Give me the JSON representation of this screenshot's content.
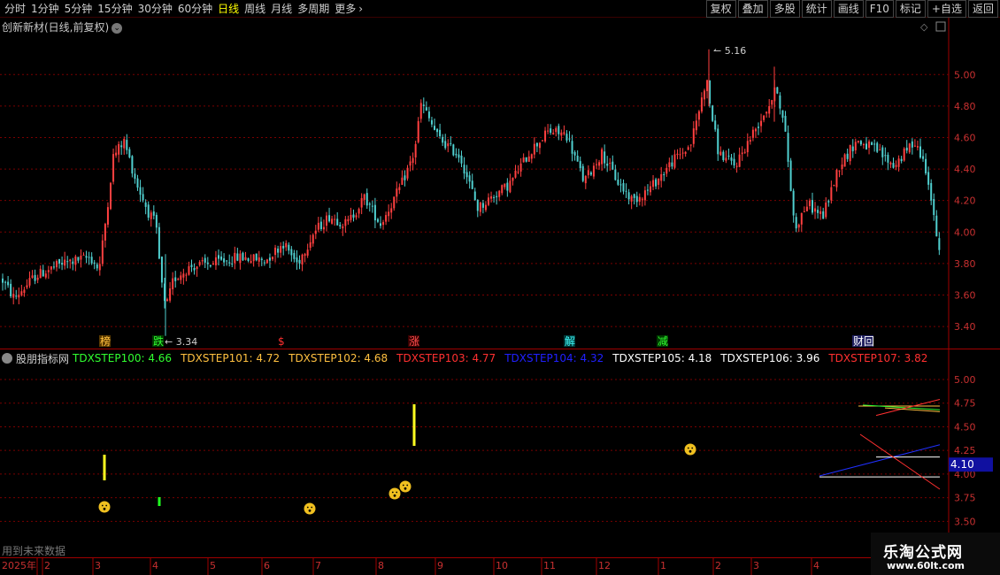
{
  "toolbar": {
    "periods": [
      "分时",
      "1分钟",
      "5分钟",
      "15分钟",
      "30分钟",
      "60分钟",
      "日线",
      "周线",
      "月线",
      "多周期",
      "更多"
    ],
    "active_period": "日线",
    "more_arrow": "›",
    "buttons": [
      "复权",
      "叠加",
      "多股",
      "统计",
      "画线",
      "F10",
      "标记",
      "+自选",
      "返回"
    ]
  },
  "subtitle": "创新新材(日线,前复权)",
  "price_axis": {
    "ticks": [
      "5.00",
      "4.80",
      "4.60",
      "4.40",
      "4.20",
      "4.00",
      "3.80",
      "3.60",
      "3.40"
    ],
    "tick_values": [
      5.0,
      4.8,
      4.6,
      4.4,
      4.2,
      4.0,
      3.8,
      3.6,
      3.4
    ],
    "ylim": [
      3.26,
      5.26
    ]
  },
  "annotations": {
    "high": "5.16",
    "low": "3.34"
  },
  "markers": [
    {
      "label": "榜",
      "color": "#ffc040",
      "bg": "#5a3a00"
    },
    {
      "label": "跌",
      "color": "#30ff30",
      "bg": "#003a00"
    },
    {
      "label": "$",
      "color": "#ff3030",
      "bg": "#000000"
    },
    {
      "label": "涨",
      "color": "#ff5050",
      "bg": "#3a0000"
    },
    {
      "label": "解",
      "color": "#40ffff",
      "bg": "#003a3a"
    },
    {
      "label": "减",
      "color": "#30ff30",
      "bg": "#003a00"
    },
    {
      "label": "财回",
      "color": "#ffffff",
      "bg": "#202060"
    }
  ],
  "indicator": {
    "name": "股朋指标网",
    "values": [
      {
        "label": "TDXSTEP100: 4.66",
        "color": "#30ff30"
      },
      {
        "label": "TDXSTEP101: 4.72",
        "color": "#ffc040"
      },
      {
        "label": "TDXSTEP102: 4.68",
        "color": "#ffc040"
      },
      {
        "label": "TDXSTEP103: 4.77",
        "color": "#ff3030"
      },
      {
        "label": "TDXSTEP104: 4.32",
        "color": "#2020ff"
      },
      {
        "label": "TDXSTEP105: 4.18",
        "color": "#ffffff"
      },
      {
        "label": "TDXSTEP106: 3.96",
        "color": "#ffffff"
      },
      {
        "label": "TDXSTEP107: 3.82",
        "color": "#ff3030"
      }
    ],
    "axis_ticks": [
      "5.00",
      "4.75",
      "4.50",
      "4.25",
      "4.00",
      "3.75",
      "3.50"
    ],
    "axis_values": [
      5.0,
      4.75,
      4.5,
      4.25,
      4.0,
      3.75,
      3.5
    ],
    "ylim": [
      3.4,
      5.15
    ],
    "current_value": "4.10"
  },
  "future_note": "用到未来数据",
  "date_axis": [
    "2025年",
    "2",
    "3",
    "4",
    "5",
    "6",
    "7",
    "8",
    "9",
    "10",
    "11",
    "12",
    "1",
    "2",
    "3",
    "4"
  ],
  "watermark": {
    "title": "乐淘公式网",
    "url": "www.60lt.com"
  },
  "colors": {
    "up": "#ff4040",
    "down": "#50d0d0",
    "grid": "#7a0000",
    "axis_text": "#c83030"
  },
  "chart_data": {
    "type": "candlestick",
    "ylim": [
      3.26,
      5.26
    ],
    "annotated_high": 5.16,
    "annotated_low": 3.34
  }
}
